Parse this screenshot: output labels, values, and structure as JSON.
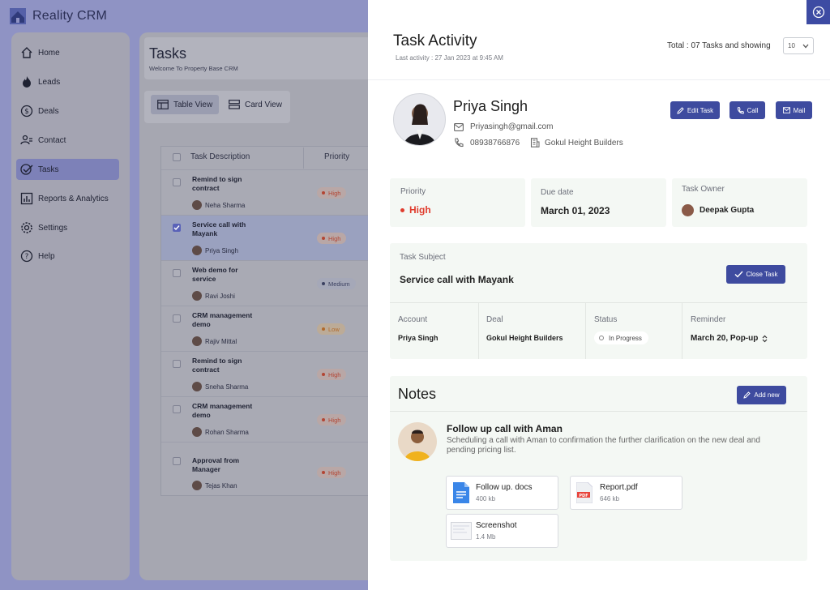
{
  "app": {
    "title": "Reality CRM"
  },
  "sidebar": {
    "items": [
      {
        "label": "Home",
        "icon": "home-icon"
      },
      {
        "label": "Leads",
        "icon": "flame-icon"
      },
      {
        "label": "Deals",
        "icon": "dollar-icon"
      },
      {
        "label": "Contact",
        "icon": "contacts-icon"
      },
      {
        "label": "Tasks",
        "icon": "tasks-icon",
        "active": true
      },
      {
        "label": "Reports & Analytics",
        "icon": "chart-icon"
      },
      {
        "label": "Settings",
        "icon": "gear-icon"
      },
      {
        "label": "Help",
        "icon": "help-icon"
      }
    ]
  },
  "tasks_page": {
    "title": "Tasks",
    "subtitle": "Welcome To Property Base CRM",
    "views": [
      "Table View",
      "Card View"
    ],
    "columns": [
      "Task Description",
      "Priority"
    ],
    "rows": [
      {
        "title": "Remind to sign contract",
        "assignee": "Neha Sharma",
        "priority": "High"
      },
      {
        "title": "Service call with Mayank",
        "assignee": "Priya Singh",
        "priority": "High",
        "selected": true
      },
      {
        "title": "Web demo for service",
        "assignee": "Ravi Joshi",
        "priority": "Medium"
      },
      {
        "title": "CRM management demo",
        "assignee": "Rajiv Mittal",
        "priority": "Low"
      },
      {
        "title": "Remind to sign contract",
        "assignee": "Sneha Sharma",
        "priority": "High"
      },
      {
        "title": "CRM management demo",
        "assignee": "Rohan Sharma",
        "priority": "High"
      },
      {
        "title": "Approval from Manager",
        "assignee": "Tejas Khan",
        "priority": "High"
      }
    ]
  },
  "panel": {
    "title": "Task Activity",
    "last_activity": "Last activity : 27 Jan 2023 at 9:45 AM",
    "total": "Total : 07 Tasks and showing",
    "page_size": "10",
    "contact": {
      "name": "Priya Singh",
      "email": "Priyasingh@gmail.com",
      "phone": "08938766876",
      "company": "Gokul Height Builders"
    },
    "actions": {
      "edit": "Edit Task",
      "call": "Call",
      "mail": "Mail"
    },
    "priority": {
      "label": "Priority",
      "value": "High"
    },
    "due": {
      "label": "Due date",
      "value": "March 01, 2023"
    },
    "owner": {
      "label": "Task Owner",
      "value": "Deepak Gupta"
    },
    "subject": {
      "label": "Task Subject",
      "value": "Service call with Mayank",
      "close_btn": "Close Task"
    },
    "details": {
      "account": {
        "label": "Account",
        "value": "Priya Singh"
      },
      "deal": {
        "label": "Deal",
        "value": "Gokul Height Builders"
      },
      "status": {
        "label": "Status",
        "value": "In Progress"
      },
      "reminder": {
        "label": "Reminder",
        "value": "March 20, Pop-up"
      }
    },
    "notes": {
      "title": "Notes",
      "add_btn": "Add new",
      "item": {
        "title": "Follow up call with Aman",
        "body": "Scheduling a call with Aman to confirmation the further clarification on the new deal and pending pricing list."
      },
      "files": [
        {
          "name": "Follow up. docs",
          "size": "400 kb",
          "icon": "doc-icon"
        },
        {
          "name": "Report.pdf",
          "size": "646 kb",
          "icon": "pdf-icon"
        },
        {
          "name": "Screenshot",
          "size": "1.4 Mb",
          "icon": "image-icon"
        }
      ]
    }
  },
  "colors": {
    "accent": "#3e4b9f",
    "high": "#e03c2d",
    "overlay": "#8f93c4"
  }
}
